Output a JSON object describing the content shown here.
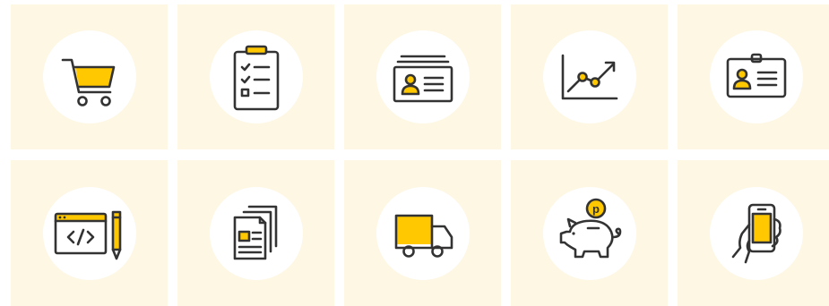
{
  "colors": {
    "tile_background": "#fdf7e4",
    "circle_background": "#ffffff",
    "accent": "#ffc800",
    "outline": "#333333"
  },
  "icons": [
    {
      "name": "shopping-cart-icon"
    },
    {
      "name": "clipboard-checklist-icon"
    },
    {
      "name": "profile-card-stack-icon"
    },
    {
      "name": "growth-chart-icon"
    },
    {
      "name": "id-badge-icon"
    },
    {
      "name": "code-editor-pencil-icon"
    },
    {
      "name": "documents-icon"
    },
    {
      "name": "delivery-truck-icon"
    },
    {
      "name": "piggy-bank-coin-icon",
      "coin_label": "p"
    },
    {
      "name": "mobile-phone-hand-icon"
    }
  ]
}
